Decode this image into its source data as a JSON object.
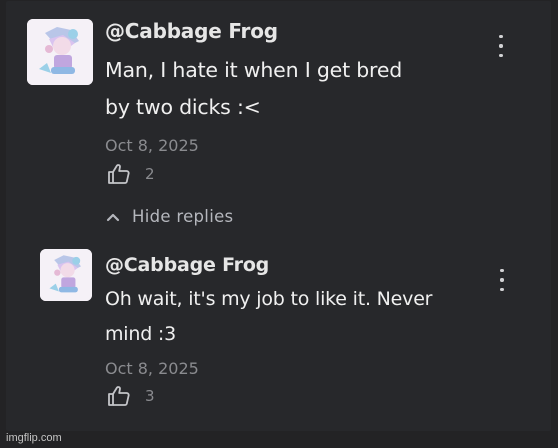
{
  "comments": [
    {
      "author": "@Cabbage Frog",
      "lines": [
        "Man, I hate it when I get bred",
        "by two dicks :<"
      ],
      "date": "Oct 8, 2025",
      "likes": "2",
      "icons": {
        "like": "thumbs-up-icon",
        "menu": "more-vertical-icon"
      }
    },
    {
      "author": "@Cabbage Frog",
      "lines": [
        "Oh wait, it's my job to like it. Never",
        "mind :3"
      ],
      "date": "Oct 8, 2025",
      "likes": "3",
      "icons": {
        "like": "thumbs-up-icon",
        "menu": "more-vertical-icon"
      }
    }
  ],
  "replies_toggle": {
    "label": "Hide replies",
    "icon": "chevron-up-icon"
  },
  "watermark": "imgflip.com",
  "colors": {
    "background": "#27282b",
    "text": "#f0f0f0",
    "muted": "#8a8b8f",
    "link": "#b5b7bd"
  }
}
